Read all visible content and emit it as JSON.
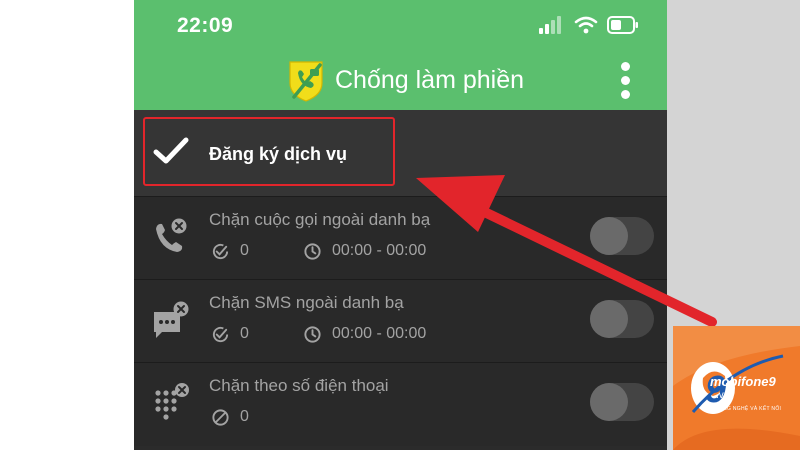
{
  "status_bar": {
    "time": "22:09"
  },
  "app_bar": {
    "title": "Chống làm phiền",
    "logo_icon": "shield-no-phone-icon",
    "menu_icon": "more-vert-icon"
  },
  "register": {
    "label": "Đăng ký dịch vụ",
    "icon": "checkmark-icon",
    "highlight_color": "#e2252b"
  },
  "features": [
    {
      "title": "Chặn cuộc gọi ngoài danh bạ",
      "icon": "blocked-call-icon",
      "count_icon": "check-circle-icon",
      "count": "0",
      "time_range": "00:00 - 00:00",
      "enabled": false
    },
    {
      "title": "Chặn SMS ngoài danh bạ",
      "icon": "blocked-sms-icon",
      "count_icon": "check-circle-icon",
      "count": "0",
      "time_range": "00:00 - 00:00",
      "enabled": false
    },
    {
      "title": "Chặn theo số điện thoại",
      "icon": "blocked-dialpad-icon",
      "count_icon": "block-circle-icon",
      "count": "0",
      "enabled": false
    }
  ],
  "annotation": {
    "type": "arrow",
    "color": "#e2252b"
  },
  "watermark": {
    "brand": "mobifone9",
    "domain": ".vn",
    "tagline": "CÔNG NGHỆ VÀ KẾT NỐI",
    "color": "#f07a2b"
  },
  "colors": {
    "app_green": "#5bbf6e",
    "list_background": "#292929",
    "text_gray": "#a3a3a3"
  }
}
